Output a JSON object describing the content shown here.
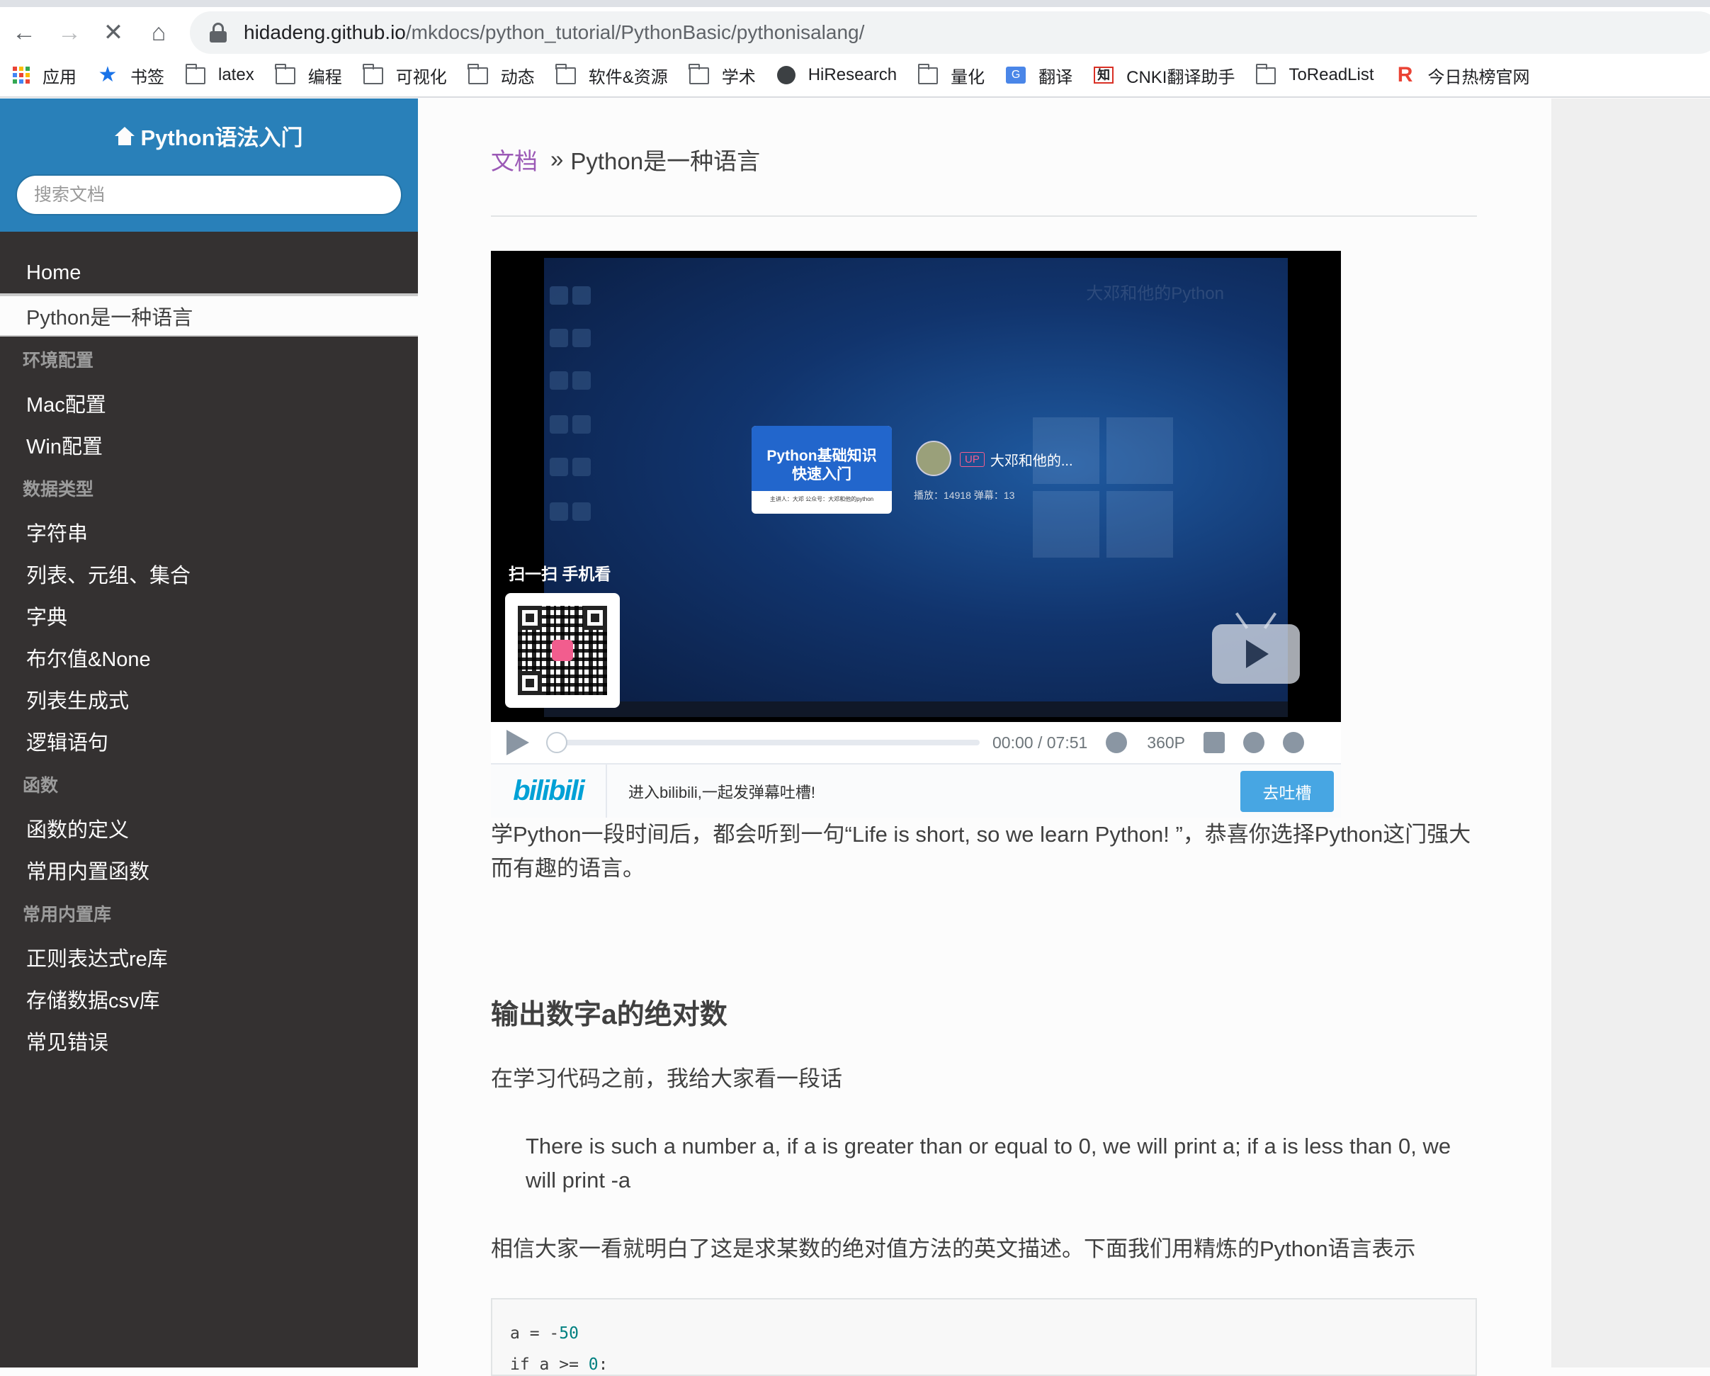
{
  "browser": {
    "url_host": "hidadeng.github.io",
    "url_path": "/mkdocs/python_tutorial/PythonBasic/pythonisalang/",
    "bookmarks": [
      {
        "label": "应用",
        "icon": "apps-grid-icon"
      },
      {
        "label": "书签",
        "icon": "star-icon"
      },
      {
        "label": "latex",
        "icon": "folder-icon"
      },
      {
        "label": "编程",
        "icon": "folder-icon"
      },
      {
        "label": "可视化",
        "icon": "folder-icon"
      },
      {
        "label": "动态",
        "icon": "folder-icon"
      },
      {
        "label": "软件&资源",
        "icon": "folder-icon"
      },
      {
        "label": "学术",
        "icon": "folder-icon"
      },
      {
        "label": "HiResearch",
        "icon": "globe-icon"
      },
      {
        "label": "量化",
        "icon": "folder-icon"
      },
      {
        "label": "翻译",
        "icon": "translate-icon"
      },
      {
        "label": "CNKI翻译助手",
        "icon": "cnki-icon"
      },
      {
        "label": "ToReadList",
        "icon": "folder-icon"
      },
      {
        "label": "今日热榜官网",
        "icon": "r-logo-icon"
      }
    ]
  },
  "sidebar": {
    "title": "Python语法入门",
    "search_placeholder": "搜索文档",
    "items": [
      {
        "type": "link",
        "label": "Home"
      },
      {
        "type": "current",
        "label": "Python是一种语言"
      },
      {
        "type": "caption",
        "label": "环境配置"
      },
      {
        "type": "link",
        "label": "Mac配置"
      },
      {
        "type": "link",
        "label": "Win配置"
      },
      {
        "type": "caption",
        "label": "数据类型"
      },
      {
        "type": "link",
        "label": "字符串"
      },
      {
        "type": "link",
        "label": "列表、元组、集合"
      },
      {
        "type": "link",
        "label": "字典"
      },
      {
        "type": "link",
        "label": "布尔值&None"
      },
      {
        "type": "link",
        "label": "列表生成式"
      },
      {
        "type": "link",
        "label": "逻辑语句"
      },
      {
        "type": "caption",
        "label": "函数"
      },
      {
        "type": "link",
        "label": "函数的定义"
      },
      {
        "type": "link",
        "label": "常用内置函数"
      },
      {
        "type": "caption",
        "label": "常用内置库"
      },
      {
        "type": "link",
        "label": "正则表达式re库"
      },
      {
        "type": "link",
        "label": "存储数据csv库"
      },
      {
        "type": "link",
        "label": "常见错误"
      }
    ]
  },
  "breadcrumb": {
    "docs_link": "文档",
    "separator": "»",
    "current": "Python是一种语言"
  },
  "video": {
    "card_title_line1": "Python基础知识",
    "card_title_line2": "快速入门",
    "card_subtitle": "主讲人：大邓 公众号：大邓和他的python",
    "up_badge": "UP",
    "up_name": "大邓和他的...",
    "stats": "播放：14918    弹幕：13",
    "watermark": "大邓和他的Python",
    "scan_text": "扫一扫 手机看",
    "time_current": "00:00",
    "time_sep": "/",
    "time_total": "07:51",
    "quality": "360P",
    "progress_fraction": 0,
    "bili_logo": "bilibili",
    "bar_text": "进入bilibili,一起发弹幕吐槽!",
    "bar_button": "去吐槽"
  },
  "content": {
    "intro": "学Python一段时间后，都会听到一句“Life is short, so we learn Python! ”，恭喜你选择Python这门强大而有趣的语言。",
    "heading": "输出数字a的绝对数",
    "p1": "在学习代码之前，我给大家看一段话",
    "quote": "There is such a number a, if a is greater than or equal to 0, we will print a; if a is less than 0, we will print -a",
    "p2": "相信大家一看就明白了这是求某数的绝对值方法的英文描述。下面我们用精炼的Python语言表示",
    "code_line1_prefix": "a = -",
    "code_line1_num": "50",
    "code_line2_prefix": "if a >= ",
    "code_line2_num": "0",
    "code_line2_suffix": ":"
  },
  "colors": {
    "sidebar_bg": "#343131",
    "sidebar_header": "#2980b9",
    "link": "#9b59b6",
    "bili_blue": "#00a1d6"
  }
}
